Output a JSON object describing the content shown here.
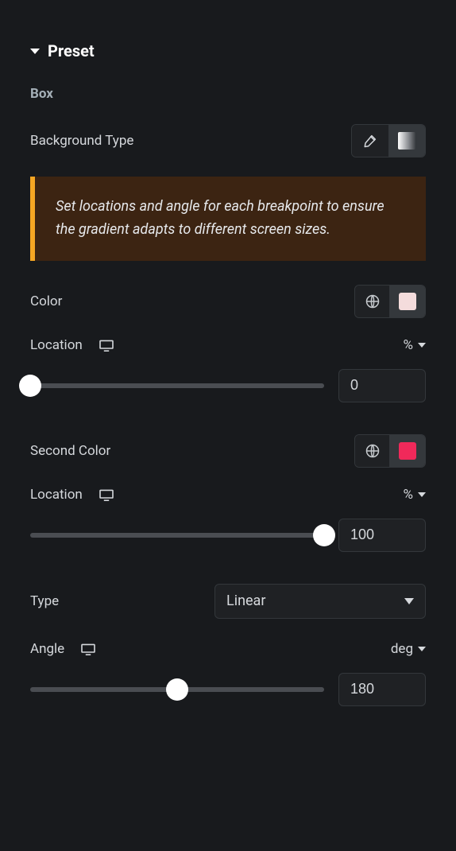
{
  "section": {
    "title": "Preset"
  },
  "box": {
    "heading": "Box"
  },
  "backgroundType": {
    "label": "Background Type",
    "selected": "gradient"
  },
  "notice": {
    "text": "Set locations and angle for each breakpoint to ensure the gradient adapts to different screen sizes."
  },
  "color1": {
    "label": "Color",
    "swatch": "#f4dcdc",
    "location": {
      "label": "Location",
      "unit": "%",
      "value": "0",
      "percent": 0
    }
  },
  "color2": {
    "label": "Second Color",
    "swatch": "#f0295a",
    "location": {
      "label": "Location",
      "unit": "%",
      "value": "100",
      "percent": 100
    }
  },
  "type": {
    "label": "Type",
    "value": "Linear"
  },
  "angle": {
    "label": "Angle",
    "unit": "deg",
    "value": "180",
    "percent": 50
  }
}
